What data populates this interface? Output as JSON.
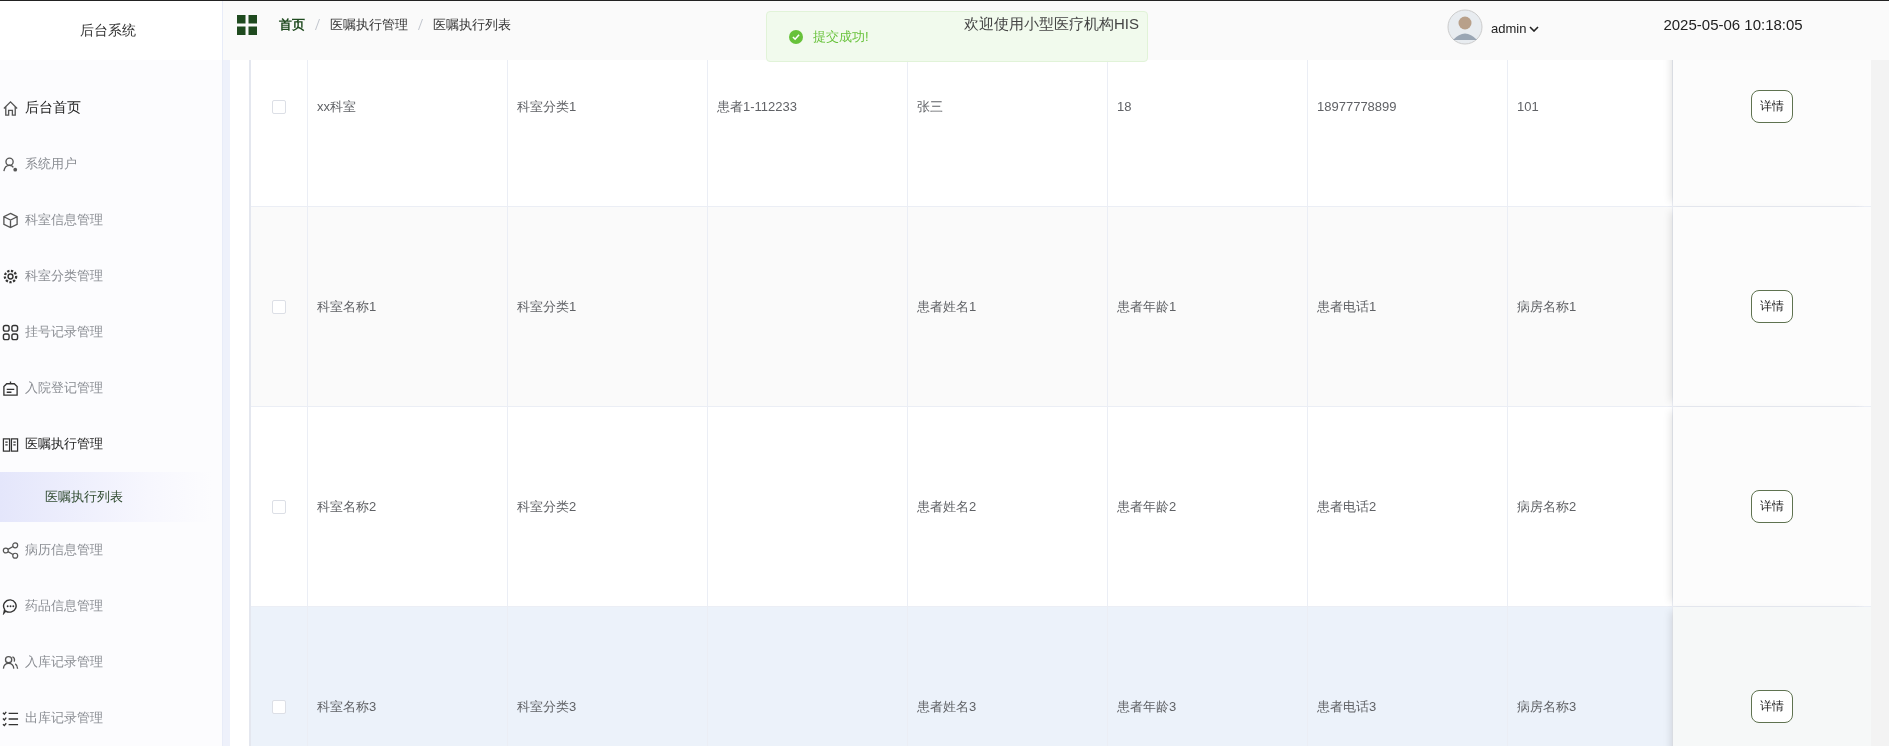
{
  "sidebar": {
    "title": "后台系统",
    "items": [
      {
        "label": "后台首页",
        "kind": "link"
      },
      {
        "label": "系统用户",
        "kind": "menu",
        "expanded": false
      },
      {
        "label": "科室信息管理",
        "kind": "menu",
        "expanded": false
      },
      {
        "label": "科室分类管理",
        "kind": "menu",
        "expanded": false
      },
      {
        "label": "挂号记录管理",
        "kind": "menu",
        "expanded": false
      },
      {
        "label": "入院登记管理",
        "kind": "menu",
        "expanded": false
      },
      {
        "label": "医嘱执行管理",
        "kind": "menu",
        "expanded": true,
        "children": [
          {
            "label": "医嘱执行列表",
            "selected": true
          }
        ]
      },
      {
        "label": "病历信息管理",
        "kind": "menu",
        "expanded": false
      },
      {
        "label": "药品信息管理",
        "kind": "menu",
        "expanded": false
      },
      {
        "label": "入库记录管理",
        "kind": "menu",
        "expanded": false
      },
      {
        "label": "出库记录管理",
        "kind": "menu",
        "expanded": false
      }
    ]
  },
  "header": {
    "breadcrumb": [
      "首页",
      "医嘱执行管理",
      "医嘱执行列表"
    ],
    "welcome": "欢迎使用小型医疗机构HIS",
    "user": "admin",
    "datetime": "2025-05-06 10:18:05"
  },
  "toast": {
    "message": "提交成功!"
  },
  "table": {
    "rows": [
      {
        "checked": false,
        "highlighted": false,
        "column_1": "xx科室",
        "column_2": "科室分类1",
        "column_3": "患者1-112233",
        "column_4": "张三",
        "column_5": "18",
        "column_6": "18977778899",
        "column_7": "101",
        "action": "详情"
      },
      {
        "checked": false,
        "highlighted": false,
        "column_1": "科室名称1",
        "column_2": "科室分类1",
        "column_4": "患者姓名1",
        "column_5": "患者年龄1",
        "column_6": "患者电话1",
        "column_7": "病房名称1",
        "action": "详情"
      },
      {
        "checked": false,
        "highlighted": false,
        "column_1": "科室名称2",
        "column_2": "科室分类2",
        "column_4": "患者姓名2",
        "column_5": "患者年龄2",
        "column_6": "患者电话2",
        "column_7": "病房名称2",
        "action": "详情"
      },
      {
        "checked": false,
        "highlighted": true,
        "column_1": "科室名称3",
        "column_2": "科室分类3",
        "column_4": "患者姓名3",
        "column_5": "患者年龄3",
        "column_6": "患者电话3",
        "column_7": "病房名称3",
        "action": "详情"
      }
    ]
  }
}
